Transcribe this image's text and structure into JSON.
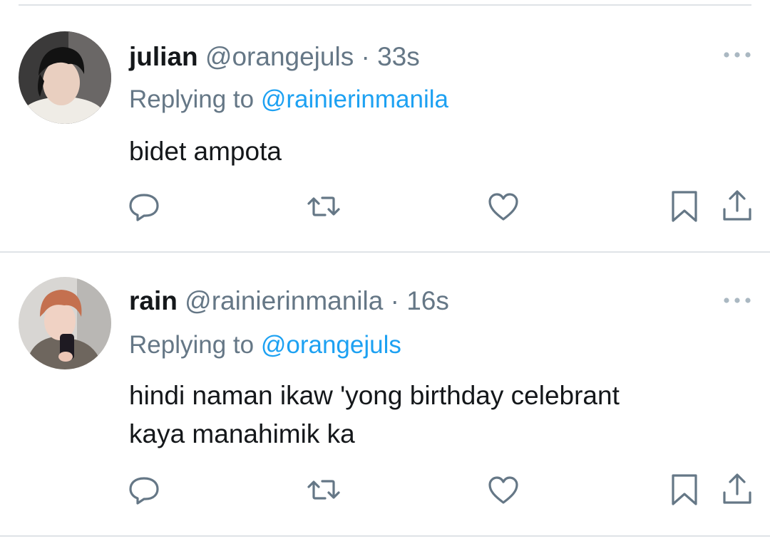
{
  "tweets": [
    {
      "name": "julian",
      "handle": "@orangejuls",
      "separator": "·",
      "time": "33s",
      "replying_prefix": "Replying to ",
      "replying_to": "@rainierinmanila",
      "text": "bidet ampota",
      "avatar_icon": "avatar-photo",
      "actions": [
        "reply-icon",
        "retweet-icon",
        "like-icon",
        "bookmark-icon",
        "share-icon"
      ]
    },
    {
      "name": "rain",
      "handle": "@rainierinmanila",
      "separator": "·",
      "time": "16s",
      "replying_prefix": "Replying to ",
      "replying_to": "@orangejuls",
      "text_line1": "hindi naman ikaw 'yong birthday celebrant",
      "text_line2": "kaya manahimik ka",
      "avatar_icon": "avatar-photo",
      "actions": [
        "reply-icon",
        "retweet-icon",
        "like-icon",
        "bookmark-icon",
        "share-icon"
      ]
    }
  ],
  "colors": {
    "text": "#14171a",
    "secondary": "#657786",
    "link": "#1da1f2",
    "divider": "#dfe3e7"
  }
}
